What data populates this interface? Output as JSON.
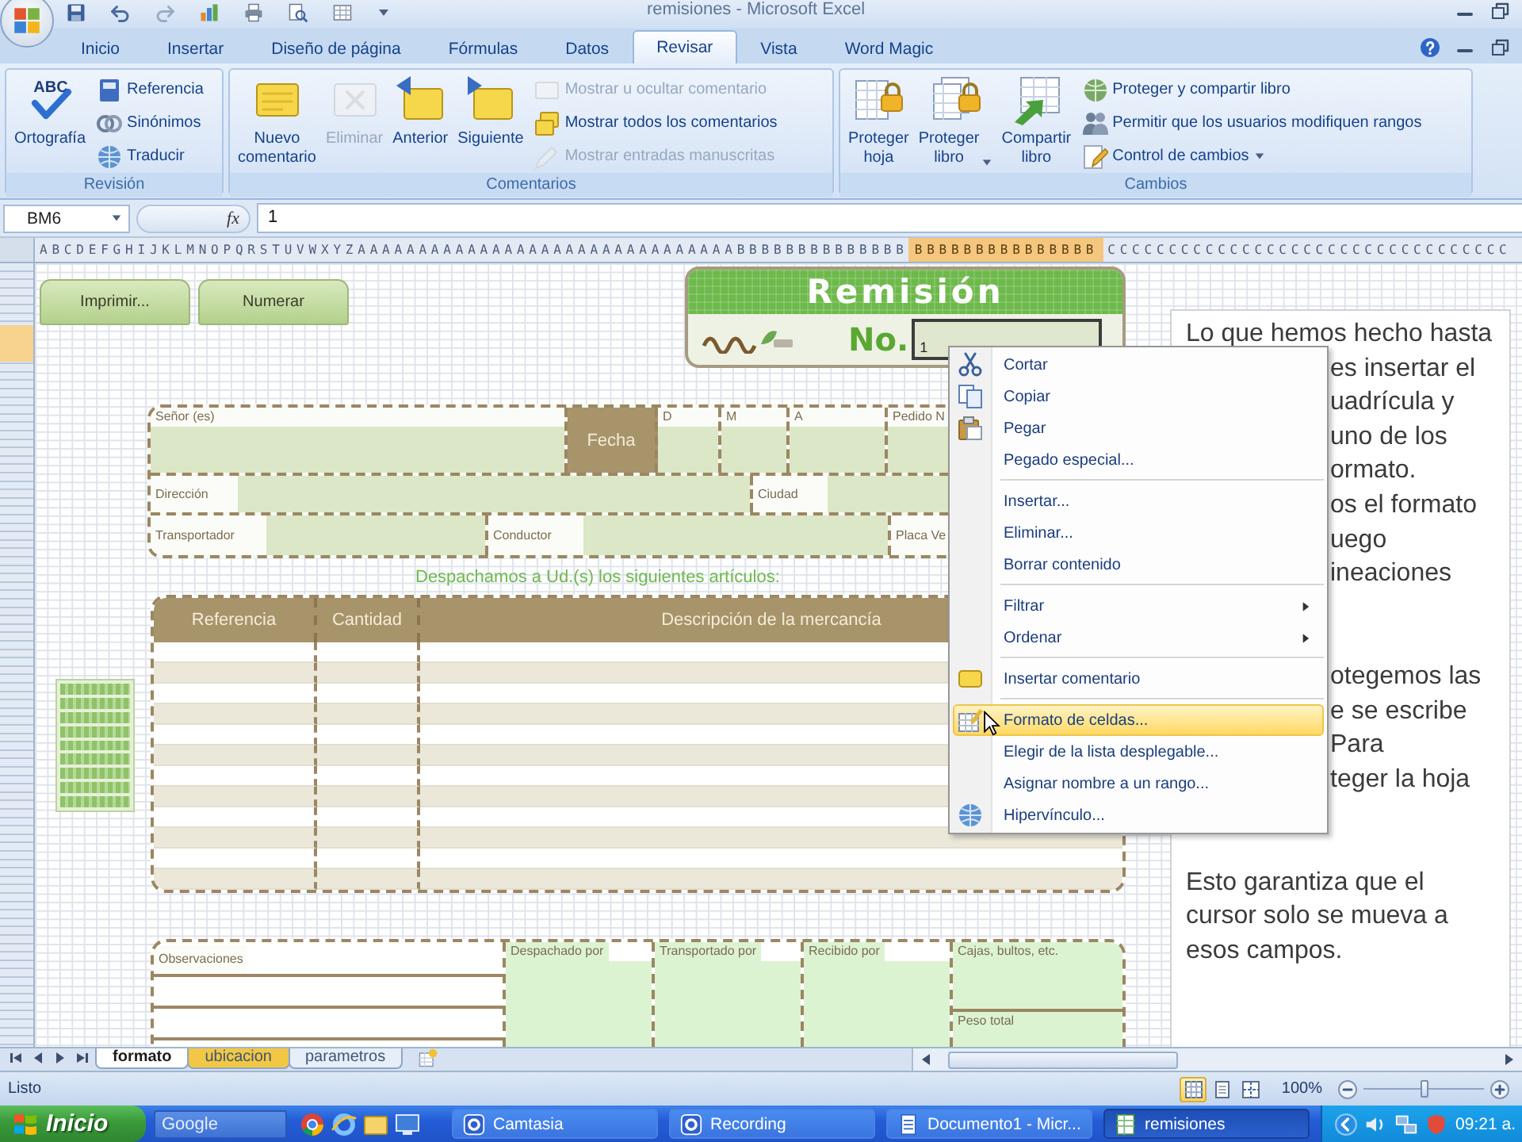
{
  "window": {
    "title": "remisiones - Microsoft Excel"
  },
  "ribbon_tabs": [
    {
      "label": "Inicio",
      "selected": false
    },
    {
      "label": "Insertar",
      "selected": false
    },
    {
      "label": "Diseño de página",
      "selected": false
    },
    {
      "label": "Fórmulas",
      "selected": false
    },
    {
      "label": "Datos",
      "selected": false
    },
    {
      "label": "Revisar",
      "selected": true
    },
    {
      "label": "Vista",
      "selected": false
    },
    {
      "label": "Word Magic",
      "selected": false
    }
  ],
  "ribbon_groups": [
    {
      "label": "Revisión",
      "buttons": [
        {
          "label": "Ortografía",
          "kind": "large",
          "icon_text": "ABC",
          "disabled": false,
          "dropdown": false
        },
        {
          "label": "Referencia",
          "kind": "small",
          "disabled": false,
          "dropdown": false
        },
        {
          "label": "Sinónimos",
          "kind": "small",
          "disabled": false,
          "dropdown": false
        },
        {
          "label": "Traducir",
          "kind": "small",
          "disabled": false,
          "dropdown": false
        }
      ]
    },
    {
      "label": "Comentarios",
      "buttons": [
        {
          "label": "Nuevo comentario",
          "kind": "large",
          "disabled": false,
          "dropdown": false
        },
        {
          "label": "Eliminar",
          "kind": "large",
          "disabled": true,
          "dropdown": false
        },
        {
          "label": "Anterior",
          "kind": "large",
          "disabled": false,
          "dropdown": false
        },
        {
          "label": "Siguiente",
          "kind": "large",
          "disabled": false,
          "dropdown": false
        },
        {
          "label": "Mostrar u ocultar comentario",
          "kind": "small",
          "disabled": true,
          "dropdown": false
        },
        {
          "label": "Mostrar todos los comentarios",
          "kind": "small",
          "disabled": false,
          "dropdown": false
        },
        {
          "label": "Mostrar entradas manuscritas",
          "kind": "small",
          "disabled": true,
          "dropdown": false
        }
      ]
    },
    {
      "label": "Cambios",
      "buttons": [
        {
          "label": "Proteger hoja",
          "kind": "large",
          "disabled": false,
          "dropdown": false
        },
        {
          "label": "Proteger libro",
          "kind": "large",
          "disabled": false,
          "dropdown": true
        },
        {
          "label": "Compartir libro",
          "kind": "large",
          "disabled": false,
          "dropdown": false
        },
        {
          "label": "Proteger y compartir libro",
          "kind": "small",
          "disabled": false,
          "dropdown": false
        },
        {
          "label": "Permitir que los usuarios modifiquen rangos",
          "kind": "small",
          "disabled": false,
          "dropdown": false
        },
        {
          "label": "Control de cambios",
          "kind": "small",
          "disabled": false,
          "dropdown": true
        }
      ]
    }
  ],
  "formula_bar": {
    "name_box": "BM6",
    "function_button": "fx",
    "value": "1"
  },
  "column_headers": [
    {
      "label": "ABCDEFGHIJKLMNOPQRSTUVWXYZAAAAAAAAAAAAAAAAAAAAAAAAAAAAAAABBBBBBBBBBBBBB",
      "selected": false
    },
    {
      "label": "BBBBBBBBBBBBBBB",
      "selected": true
    },
    {
      "label": "CCCCCCCCCCCCCCCCCCCCCCCCCCCCCCCCC",
      "selected": false
    }
  ],
  "sheet_buttons": [
    {
      "label": "Imprimir..."
    },
    {
      "label": "Numerar"
    }
  ],
  "remision": {
    "title": "Remisión",
    "number_label": "No.",
    "number_value": "1"
  },
  "customer_form": {
    "lines": [
      {
        "fields": [
          {
            "label": "Señor (es)",
            "kind": "stacked"
          },
          {
            "label": "Fecha",
            "kind": "header"
          },
          {
            "label": "D",
            "kind": "stacked"
          },
          {
            "label": "M",
            "kind": "stacked"
          },
          {
            "label": "A",
            "kind": "stacked"
          },
          {
            "label": "Pedido N",
            "kind": "stacked"
          }
        ]
      },
      {
        "fields": [
          {
            "label": "Dirección",
            "kind": "inline"
          },
          {
            "label": "Ciudad",
            "kind": "inline"
          }
        ]
      },
      {
        "fields": [
          {
            "label": "Transportador",
            "kind": "inline"
          },
          {
            "label": "Conductor",
            "kind": "inline"
          },
          {
            "label": "Placa Ve",
            "kind": "inline"
          }
        ]
      }
    ]
  },
  "shipment_note": "Despachamos a Ud.(s) los siguientes artículos:",
  "items_table": {
    "columns": [
      {
        "label": "Referencia"
      },
      {
        "label": "Cantidad"
      },
      {
        "label": "Descripción de la mercancía"
      }
    ]
  },
  "footer_form": {
    "cells": [
      {
        "label": "Observaciones",
        "kind": "lines"
      },
      {
        "label": "Despachado por",
        "kind": "box"
      },
      {
        "label": "Transportado por",
        "kind": "box"
      },
      {
        "label": "Recibido por",
        "kind": "box"
      },
      {
        "label": "Cajas, bultos, etc.",
        "kind": "stack"
      },
      {
        "label": "Peso total",
        "kind": "stack"
      }
    ]
  },
  "note_box": {
    "paragraphs": [
      {
        "kind": "covered",
        "lines": [
          {
            "text": "Lo que hemos hecho hasta",
            "kind": "full"
          },
          {
            "text": "es insertar el",
            "kind": "partial"
          },
          {
            "text": "uadrícula y",
            "kind": "partial"
          },
          {
            "text": "uno de los",
            "kind": "partial"
          },
          {
            "text": "ormato.",
            "kind": "partial"
          },
          {
            "text": "os el formato",
            "kind": "partial"
          },
          {
            "text": "uego",
            "kind": "partial"
          },
          {
            "text": "ineaciones",
            "kind": "partial"
          }
        ]
      },
      {
        "kind": "covered",
        "lines": [
          {
            "text": "otegemos las",
            "kind": "partial"
          },
          {
            "text": "e se escribe",
            "kind": "partial"
          },
          {
            "text": "Para",
            "kind": "partial"
          },
          {
            "text": "teger la hoja",
            "kind": "partial"
          }
        ]
      },
      {
        "kind": "whole",
        "lines": [
          {
            "text": "Esto garantiza que el"
          },
          {
            "text": "cursor solo se mueva a"
          },
          {
            "text": "esos campos."
          }
        ]
      }
    ]
  },
  "context_menu": {
    "items": [
      {
        "label": "Cortar",
        "separator_before": false,
        "submenu": false,
        "selected": false
      },
      {
        "label": "Copiar",
        "separator_before": false,
        "submenu": false,
        "selected": false
      },
      {
        "label": "Pegar",
        "separator_before": false,
        "submenu": false,
        "selected": false
      },
      {
        "label": "Pegado especial...",
        "separator_before": false,
        "submenu": false,
        "selected": false
      },
      {
        "label": "Insertar...",
        "separator_before": true,
        "submenu": false,
        "selected": false
      },
      {
        "label": "Eliminar...",
        "separator_before": false,
        "submenu": false,
        "selected": false
      },
      {
        "label": "Borrar contenido",
        "separator_before": false,
        "submenu": false,
        "selected": false
      },
      {
        "label": "Filtrar",
        "separator_before": true,
        "submenu": true,
        "selected": false
      },
      {
        "label": "Ordenar",
        "separator_before": false,
        "submenu": true,
        "selected": false
      },
      {
        "label": "Insertar comentario",
        "separator_before": true,
        "submenu": false,
        "selected": false
      },
      {
        "label": "Formato de celdas...",
        "separator_before": true,
        "submenu": false,
        "selected": true
      },
      {
        "label": "Elegir de la lista desplegable...",
        "separator_before": false,
        "submenu": false,
        "selected": false
      },
      {
        "label": "Asignar nombre a un rango...",
        "separator_before": false,
        "submenu": false,
        "selected": false
      },
      {
        "label": "Hipervínculo...",
        "separator_before": false,
        "submenu": false,
        "selected": false
      }
    ]
  },
  "sheet_tabs": [
    {
      "label": "formato",
      "selected": true
    },
    {
      "label": "ubicacion",
      "selected": false,
      "color": "#f2c744"
    },
    {
      "label": "parametros",
      "selected": false
    }
  ],
  "status_bar": {
    "text": "Listo",
    "view_buttons": [
      {
        "selected": true
      },
      {
        "selected": false
      },
      {
        "selected": false
      }
    ],
    "zoom_label": "100%",
    "zoom_slider": {
      "level": 0.5
    }
  },
  "taskbar": {
    "start_label": "Inicio",
    "search_placeholder": "Google",
    "items": [
      {
        "label": "Camtasia",
        "selected": false
      },
      {
        "label": "Recording",
        "selected": false
      },
      {
        "label": "Documento1 - Micr...",
        "selected": false
      },
      {
        "label": "remisiones",
        "selected": true
      }
    ],
    "clock": "09:21 a."
  }
}
